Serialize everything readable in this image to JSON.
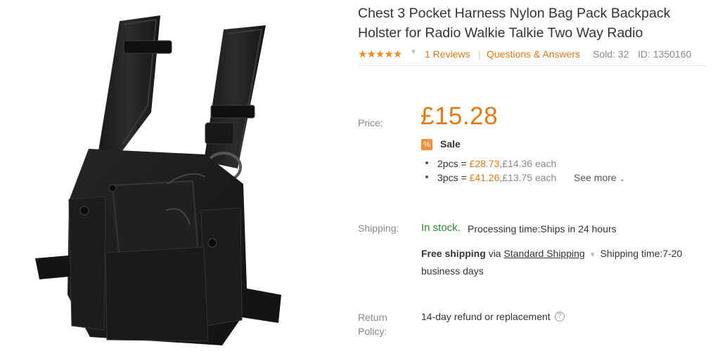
{
  "product": {
    "title": "Chest 3 Pocket Harness Nylon Bag Pack Backpack Holster for Radio Walkie Talkie Two Way Radio",
    "image_alt": "black chest harness holster product photo",
    "rating_stars": "★★★★★",
    "reviews_label": "1 Reviews",
    "qa_label": "Questions & Answers",
    "sold": "Sold: 32",
    "id": "ID: 1350160"
  },
  "pricing": {
    "label": "Price:",
    "price": "£15.28",
    "sale_icon": "%",
    "sale_label": "Sale",
    "tiers": [
      {
        "qty": "2pcs =",
        "total": "£28.73",
        "each": ",£14.36 each"
      },
      {
        "qty": "3pcs =",
        "total": "£41.26",
        "each": ",£13.75 each"
      }
    ],
    "see_more": "See more"
  },
  "shipping": {
    "label": "Shipping:",
    "stock": "In stock.",
    "processing": "Processing time:Ships in 24 hours",
    "free": "Free shipping",
    "via": "via",
    "method": "Standard Shipping",
    "time": "Shipping time:7-20 business days"
  },
  "returns": {
    "label_line1": "Return",
    "label_line2": "Policy:",
    "text": "14-day refund or replacement"
  },
  "colors": {
    "accent": "#e47911",
    "in_stock": "#2b8a2b",
    "star": "#f08a24"
  }
}
